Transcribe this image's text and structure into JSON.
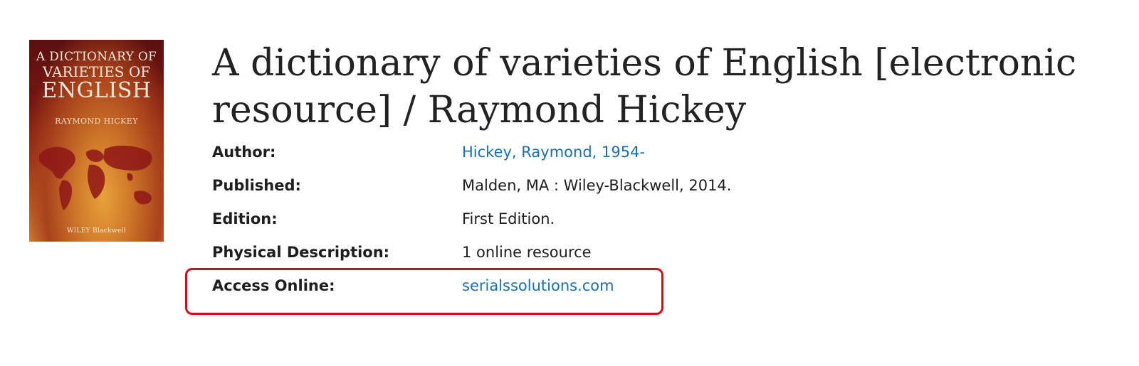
{
  "book": {
    "cover": {
      "title_line1": "A DICTIONARY OF",
      "title_line2": "VARIETIES OF",
      "title_line3": "ENGLISH",
      "author": "RAYMOND HICKEY",
      "publisher": "WILEY Blackwell"
    },
    "title": "A dictionary of varieties of English [electronic resource] / Raymond Hickey"
  },
  "details": [
    {
      "label": "Author:",
      "value": "Hickey, Raymond, 1954-",
      "is_link": true
    },
    {
      "label": "Published:",
      "value": "Malden, MA : Wiley-Blackwell, 2014.",
      "is_link": false
    },
    {
      "label": "Edition:",
      "value": "First Edition.",
      "is_link": false
    },
    {
      "label": "Physical Description:",
      "value": "1 online resource",
      "is_link": false
    },
    {
      "label": "Access Online:",
      "value": "serialssolutions.com",
      "is_link": true
    }
  ],
  "colors": {
    "link": "#1a6fb2",
    "highlight": "#c8101e",
    "text": "#1e1e1e"
  }
}
